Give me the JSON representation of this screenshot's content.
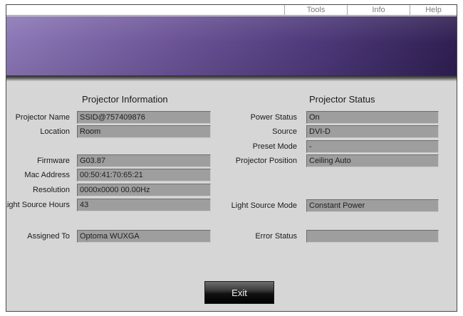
{
  "menu": {
    "tools": "Tools",
    "info": "Info",
    "help": "Help"
  },
  "projector_information": {
    "title": "Projector Information",
    "projector_name": {
      "label": "Projector Name",
      "value": "SSID@757409876"
    },
    "location": {
      "label": "Location",
      "value": "Room"
    },
    "firmware": {
      "label": "Firmware",
      "value": "G03.87"
    },
    "mac_address": {
      "label": "Mac Address",
      "value": "00:50:41:70:65:21"
    },
    "resolution": {
      "label": "Resolution",
      "value": "0000x0000  00.00Hz"
    },
    "light_source_hours": {
      "label": "Light Source Hours",
      "value": "43"
    },
    "assigned_to": {
      "label": "Assigned To",
      "value": "Optoma WUXGA"
    }
  },
  "projector_status": {
    "title": "Projector Status",
    "power_status": {
      "label": "Power Status",
      "value": "On"
    },
    "source": {
      "label": "Source",
      "value": "DVI-D"
    },
    "preset_mode": {
      "label": "Preset Mode",
      "value": "-"
    },
    "projector_position": {
      "label": "Projector Position",
      "value": "Ceiling Auto"
    },
    "light_source_mode": {
      "label": "Light Source Mode",
      "value": "Constant Power"
    },
    "error_status": {
      "label": "Error Status",
      "value": ""
    }
  },
  "exit_label": "Exit"
}
